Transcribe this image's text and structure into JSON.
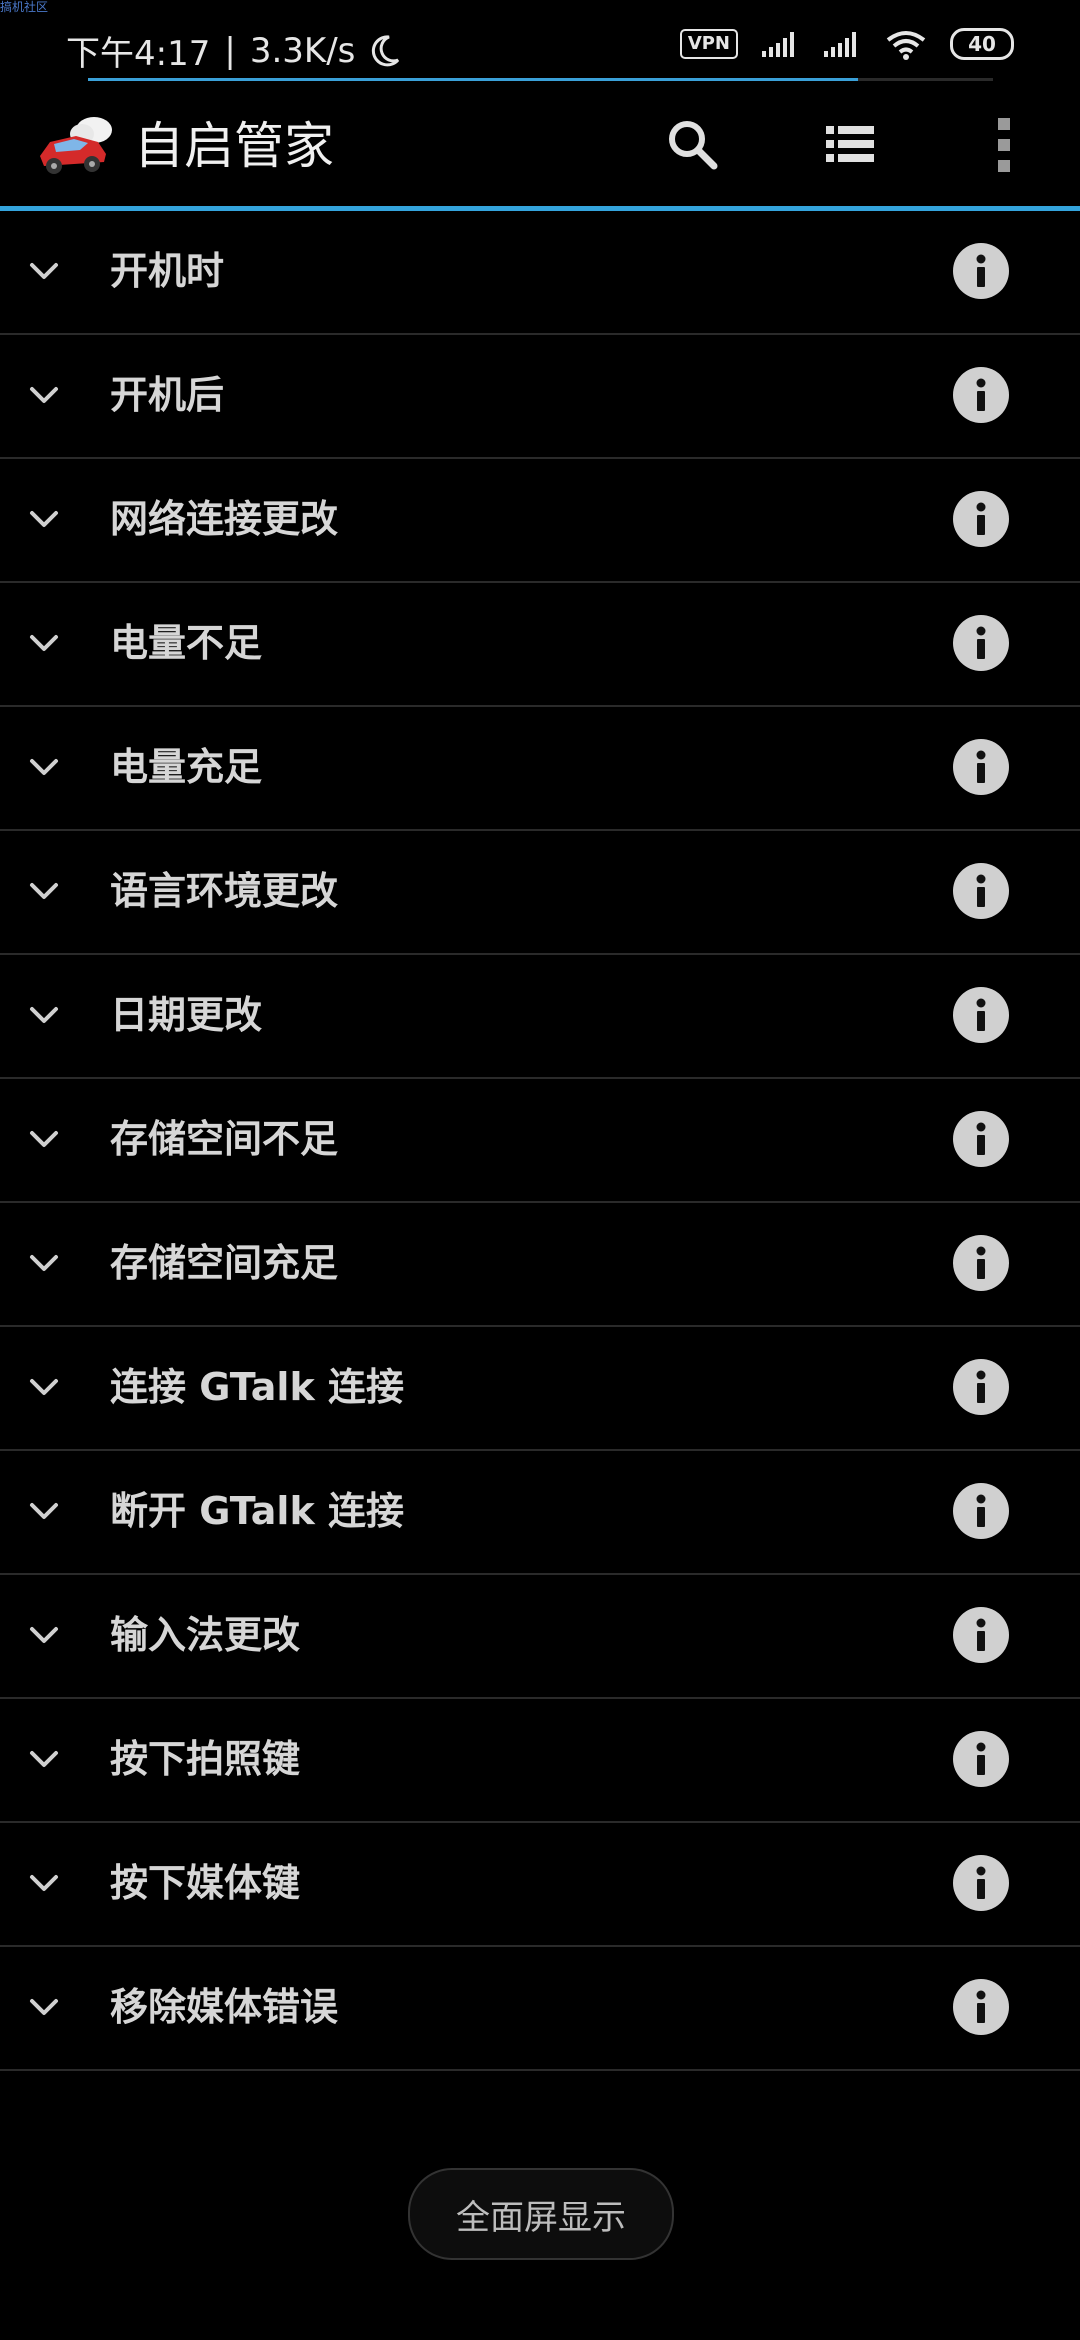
{
  "watermark": "搞机社区",
  "status_bar": {
    "time": "下午4:17",
    "separator": "|",
    "net_speed": "3.3K/s",
    "vpn": "VPN",
    "battery": "40"
  },
  "app_bar": {
    "title": "自启管家",
    "icons": [
      "search-icon",
      "list-icon",
      "more-vert-icon"
    ]
  },
  "events": [
    {
      "label": "开机时"
    },
    {
      "label": "开机后"
    },
    {
      "label": "网络连接更改"
    },
    {
      "label": "电量不足"
    },
    {
      "label": "电量充足"
    },
    {
      "label": "语言环境更改"
    },
    {
      "label": "日期更改"
    },
    {
      "label": "存储空间不足"
    },
    {
      "label": "存储空间充足"
    },
    {
      "label": "连接 GTalk 连接"
    },
    {
      "label": "断开 GTalk 连接"
    },
    {
      "label": "输入法更改"
    },
    {
      "label": "按下拍照键"
    },
    {
      "label": "按下媒体键"
    },
    {
      "label": "移除媒体错误"
    }
  ],
  "fullscreen_button": {
    "label": "全面屏显示"
  },
  "colors": {
    "background": "#000000",
    "accent": "#34a4dd",
    "divider": "#2a2a2a",
    "text": "#d6d6d6",
    "info_icon_bg": "#d0d0d0"
  }
}
